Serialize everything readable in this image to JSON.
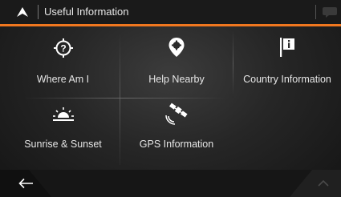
{
  "header": {
    "title": "Useful Information",
    "logo_icon": "navigation-arrow-icon",
    "chat_icon": "speech-bubble-icon"
  },
  "items": [
    {
      "label": "Where Am I",
      "icon": "location-question-icon"
    },
    {
      "label": "Help Nearby",
      "icon": "help-pin-icon"
    },
    {
      "label": "Country Information",
      "icon": "info-flag-icon"
    },
    {
      "label": "Sunrise & Sunset",
      "icon": "sunrise-icon"
    },
    {
      "label": "GPS Information",
      "icon": "satellite-icon"
    }
  ],
  "bottom": {
    "back_icon": "back-arrow-icon",
    "up_icon": "chevron-up-icon"
  },
  "colors": {
    "accent": "#f0771f",
    "header_bg": "#1a1a1a"
  }
}
